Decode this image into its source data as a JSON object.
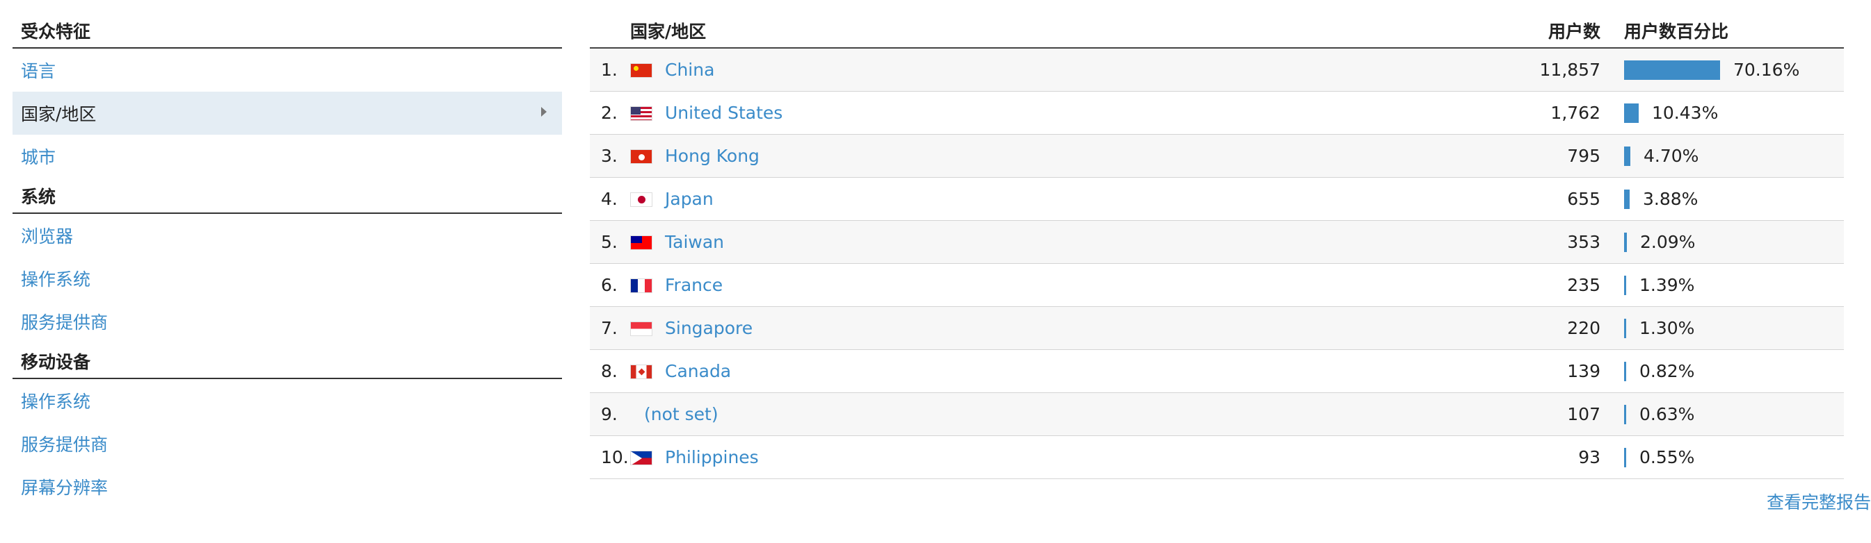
{
  "nav": {
    "sections": [
      {
        "title": "受众特征",
        "items": [
          {
            "label": "语言",
            "active": false
          },
          {
            "label": "国家/地区",
            "active": true
          },
          {
            "label": "城市",
            "active": false
          }
        ]
      },
      {
        "title": "系统",
        "items": [
          {
            "label": "浏览器",
            "active": false
          },
          {
            "label": "操作系统",
            "active": false
          },
          {
            "label": "服务提供商",
            "active": false
          }
        ]
      },
      {
        "title": "移动设备",
        "items": [
          {
            "label": "操作系统",
            "active": false
          },
          {
            "label": "服务提供商",
            "active": false
          },
          {
            "label": "屏幕分辨率",
            "active": false
          }
        ]
      }
    ]
  },
  "table": {
    "headers": {
      "country": "国家/地区",
      "users": "用户数",
      "pct": "用户数百分比"
    },
    "bar_color": "#3d8cc7",
    "rows": [
      {
        "rank": "1.",
        "flag": "cn",
        "country": "China",
        "users": "11,857",
        "pct": "70.16%",
        "pct_value": 70.16
      },
      {
        "rank": "2.",
        "flag": "us",
        "country": "United States",
        "users": "1,762",
        "pct": "10.43%",
        "pct_value": 10.43
      },
      {
        "rank": "3.",
        "flag": "hk",
        "country": "Hong Kong",
        "users": "795",
        "pct": "4.70%",
        "pct_value": 4.7
      },
      {
        "rank": "4.",
        "flag": "jp",
        "country": "Japan",
        "users": "655",
        "pct": "3.88%",
        "pct_value": 3.88
      },
      {
        "rank": "5.",
        "flag": "tw",
        "country": "Taiwan",
        "users": "353",
        "pct": "2.09%",
        "pct_value": 2.09
      },
      {
        "rank": "6.",
        "flag": "fr",
        "country": "France",
        "users": "235",
        "pct": "1.39%",
        "pct_value": 1.39
      },
      {
        "rank": "7.",
        "flag": "sg",
        "country": "Singapore",
        "users": "220",
        "pct": "1.30%",
        "pct_value": 1.3
      },
      {
        "rank": "8.",
        "flag": "ca",
        "country": "Canada",
        "users": "139",
        "pct": "0.82%",
        "pct_value": 0.82
      },
      {
        "rank": "9.",
        "flag": "",
        "country": "(not set)",
        "users": "107",
        "pct": "0.63%",
        "pct_value": 0.63
      },
      {
        "rank": "10.",
        "flag": "ph",
        "country": "Philippines",
        "users": "93",
        "pct": "0.55%",
        "pct_value": 0.55
      }
    ],
    "full_report_label": "查看完整报告"
  }
}
